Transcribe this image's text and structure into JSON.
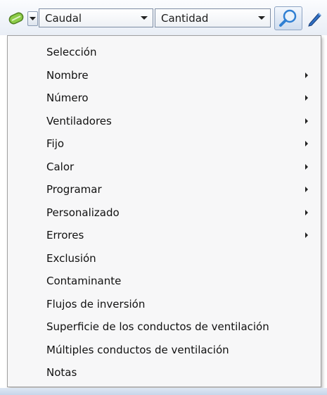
{
  "toolbar": {
    "tool_icon": "selection-tool-icon",
    "tool_menu_icon": "chevron-down-icon",
    "flow_combo": {
      "value": "Caudal"
    },
    "quantity_combo": {
      "value": "Cantidad"
    },
    "search_icon": "magnifier-icon",
    "edit_icon": "pencil-icon"
  },
  "menu": {
    "items": [
      {
        "label": "Selección",
        "has_submenu": false
      },
      {
        "label": "Nombre",
        "has_submenu": true
      },
      {
        "label": "Número",
        "has_submenu": true
      },
      {
        "label": "Ventiladores",
        "has_submenu": true
      },
      {
        "label": "Fijo",
        "has_submenu": true
      },
      {
        "label": "Calor",
        "has_submenu": true
      },
      {
        "label": "Programar",
        "has_submenu": true
      },
      {
        "label": "Personalizado",
        "has_submenu": true
      },
      {
        "label": "Errores",
        "has_submenu": true
      },
      {
        "label": "Exclusión",
        "has_submenu": false
      },
      {
        "label": "Contaminante",
        "has_submenu": false
      },
      {
        "label": "Flujos de inversión",
        "has_submenu": false
      },
      {
        "label": "Superficie de los conductos de ventilación",
        "has_submenu": false
      },
      {
        "label": "Múltiples conductos de ventilación",
        "has_submenu": false
      },
      {
        "label": "Notas",
        "has_submenu": false
      }
    ]
  },
  "colors": {
    "menu_background": "#f7f7f8",
    "toolbar_top": "#fbfcfe",
    "toolbar_bottom": "#e9eef6",
    "accent_blue": "#2f7fd3",
    "tool_green": "#7bbf3a"
  }
}
